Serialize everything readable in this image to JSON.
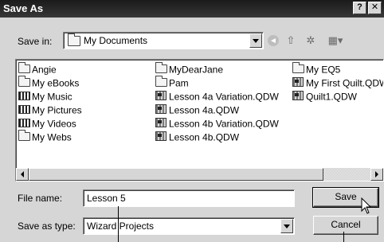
{
  "window": {
    "title": "Save As",
    "buttons": {
      "help": "?",
      "close": "✕"
    }
  },
  "toolbar": {
    "save_in_label": "Save in:",
    "save_in_value": "My Documents",
    "icons": [
      "back-arrow-icon",
      "up-folder-icon",
      "new-folder-icon",
      "views-menu-icon"
    ]
  },
  "files": {
    "columns": [
      [
        {
          "name": "Angie",
          "icon": "folder"
        },
        {
          "name": "My eBooks",
          "icon": "folder"
        },
        {
          "name": "My Music",
          "icon": "folder"
        },
        {
          "name": "My Pictures",
          "icon": "folder"
        },
        {
          "name": "My Videos",
          "icon": "folder"
        },
        {
          "name": "My Webs",
          "icon": "folder"
        }
      ],
      [
        {
          "name": "MyDearJane",
          "icon": "folder"
        },
        {
          "name": "Pam",
          "icon": "folder"
        },
        {
          "name": "Lesson 4a Variation.QDW",
          "icon": "document"
        },
        {
          "name": "Lesson 4a.QDW",
          "icon": "document"
        },
        {
          "name": "Lesson 4b Variation.QDW",
          "icon": "document"
        },
        {
          "name": "Lesson 4b.QDW",
          "icon": "document"
        }
      ],
      [
        {
          "name": "My EQ5",
          "icon": "folder"
        },
        {
          "name": "My First Quilt.QDW",
          "icon": "document"
        },
        {
          "name": "Quilt1.QDW",
          "icon": "document"
        }
      ]
    ]
  },
  "form": {
    "file_name_label": "File name:",
    "file_name_value": "Lesson 5",
    "save_as_type_label": "Save as type:",
    "save_as_type_value": "Wizard Projects",
    "save_button": "Save",
    "cancel_button": "Cancel"
  }
}
